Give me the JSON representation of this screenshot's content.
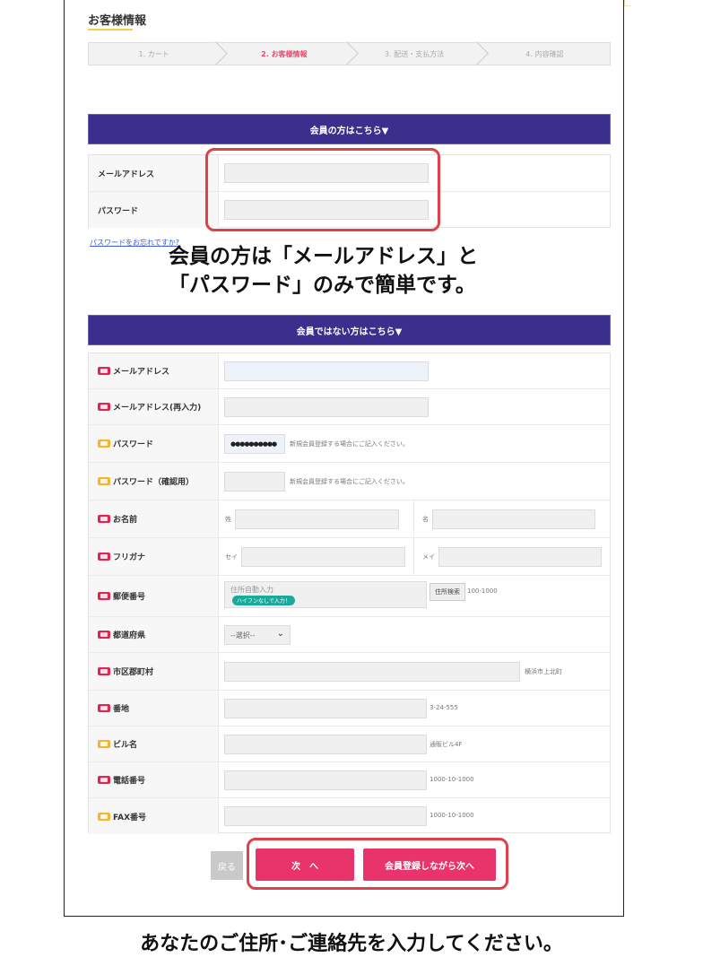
{
  "header": {
    "title": "お客様情報"
  },
  "steps": [
    {
      "label": "1. カート",
      "active": false
    },
    {
      "label": "2. お客様情報",
      "active": true
    },
    {
      "label": "3. 配送・支払方法",
      "active": false
    },
    {
      "label": "4. 内容確認",
      "active": false
    }
  ],
  "member_section": {
    "heading": "会員の方はこちら▼",
    "email_label": "メールアドレス",
    "password_label": "パスワード",
    "forgot_link": "パスワードをお忘れですか?"
  },
  "annotation": {
    "line1": "会員の方は「メールアドレス」と",
    "line2": "「パスワード」のみで簡単です。"
  },
  "guest_section": {
    "heading": "会員ではない方はこちら▼",
    "rows": {
      "email": {
        "label": "メールアドレス",
        "required": true
      },
      "email_confirm": {
        "label": "メールアドレス(再入力)",
        "required": true
      },
      "password": {
        "label": "パスワード",
        "required": false,
        "value": "●●●●●●●●●●",
        "hint": "新規会員登録する場合にご記入ください。"
      },
      "password_confirm": {
        "label": "パスワード（確認用）",
        "required": false,
        "hint": "新規会員登録する場合にご記入ください。"
      },
      "name": {
        "label": "お名前",
        "required": true,
        "sei_label": "姓",
        "mei_label": "名"
      },
      "kana": {
        "label": "フリガナ",
        "required": true,
        "sei_label": "セイ",
        "mei_label": "メイ"
      },
      "postal": {
        "label": "郵便番号",
        "required": true,
        "placeholder": "住所自動入力",
        "badge": "ハイフンなしで入力！",
        "search_button": "住所検索",
        "value": "100-1000"
      },
      "prefecture": {
        "label": "都道府県",
        "required": true,
        "select_value": "--選択--"
      },
      "city": {
        "label": "市区郡町村",
        "required": true,
        "value": "横浜市上北町"
      },
      "address": {
        "label": "番地",
        "required": true,
        "value": "3-24-555"
      },
      "building": {
        "label": "ビル名",
        "required": false,
        "value": "通販ビル4F"
      },
      "phone": {
        "label": "電話番号",
        "required": true,
        "value": "1000-10-1000"
      },
      "fax": {
        "label": "FAX番号",
        "required": false,
        "value": "1000-10-1000"
      }
    }
  },
  "buttons": {
    "back": "戻る",
    "next": "次　へ",
    "register_next": "会員登録しながら次へ"
  },
  "caption": "あなたのご住所･ご連絡先を入力してください。",
  "colors": {
    "accent": "#3a2f8c",
    "pink": "#e8336b",
    "required_tag": "#e0264f",
    "optional_tag": "#f2b632",
    "highlight": "#e0404a"
  }
}
